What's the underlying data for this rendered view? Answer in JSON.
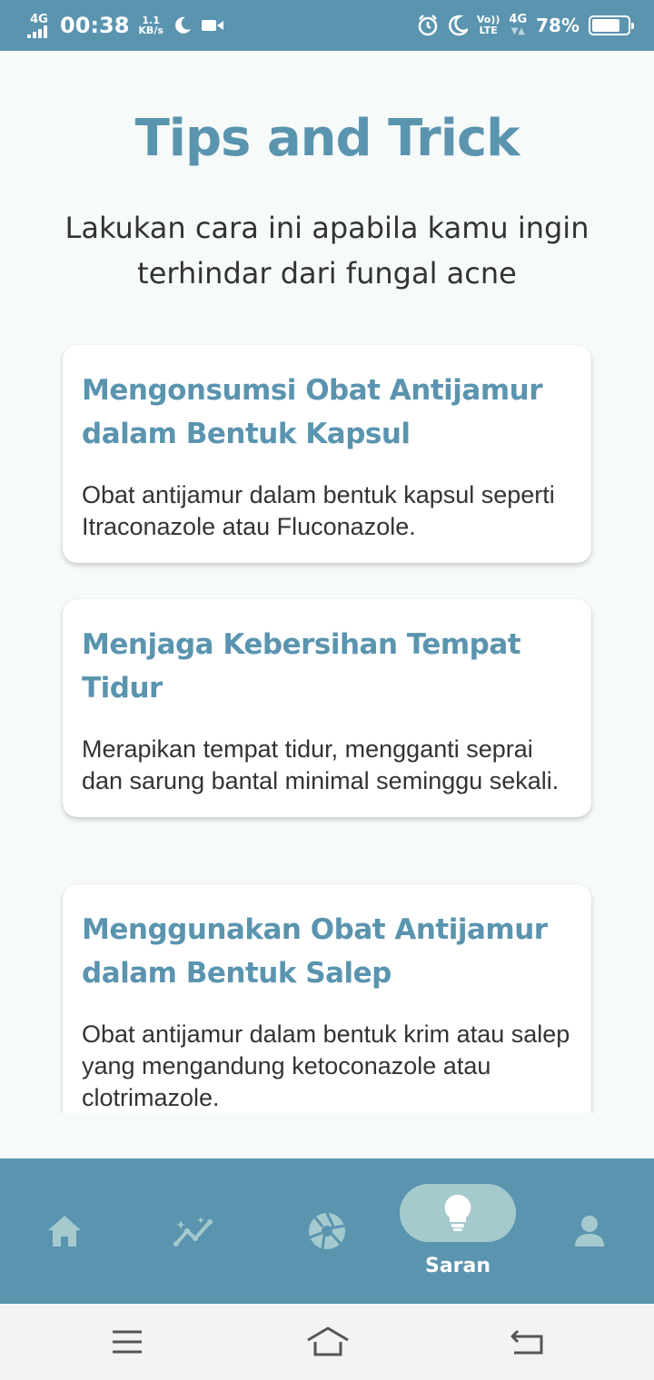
{
  "status_bar": {
    "network_type": "4G",
    "time": "00:38",
    "speed_value": "1.1",
    "speed_unit": "KB/s",
    "volte_top": "Vo))",
    "volte_bottom": "LTE",
    "network_type_2": "4G",
    "battery_percent": "78%",
    "battery_level": 0.78,
    "icons": [
      "signal-icon",
      "moon-icon",
      "video-icon",
      "alarm-icon",
      "moon-icon",
      "battery-icon"
    ]
  },
  "header": {
    "title": "Tips and Trick",
    "subtitle": "Lakukan cara ini apabila kamu ingin terhindar dari fungal acne"
  },
  "tips": [
    {
      "title": "Mengonsumsi Obat Antijamur dalam Bentuk Kapsul",
      "body": "Obat antijamur dalam bentuk kapsul seperti Itraconazole atau Fluconazole."
    },
    {
      "title": "Menjaga Kebersihan Tempat Tidur",
      "body": "Merapikan tempat tidur, mengganti seprai dan sarung bantal minimal seminggu sekali."
    },
    {
      "title": "Menggunakan Obat Antijamur dalam Bentuk Salep",
      "body": "Obat antijamur dalam bentuk krim atau salep yang mengandung ketoconazole atau clotrimazole."
    }
  ],
  "bottom_nav": {
    "items": [
      {
        "icon": "home-icon",
        "label": "",
        "active": false
      },
      {
        "icon": "trend-icon",
        "label": "",
        "active": false
      },
      {
        "icon": "aperture-icon",
        "label": "",
        "active": false
      },
      {
        "icon": "lightbulb-icon",
        "label": "Saran",
        "active": true
      },
      {
        "icon": "person-icon",
        "label": "",
        "active": false
      }
    ]
  },
  "system_nav": {
    "icons": [
      "menu-icon",
      "home-outline-icon",
      "back-icon"
    ]
  },
  "colors": {
    "primary": "#5a94af",
    "active_pill": "#a4cace",
    "background": "#f6faf8",
    "card": "#ffffff",
    "text": "#333333"
  }
}
